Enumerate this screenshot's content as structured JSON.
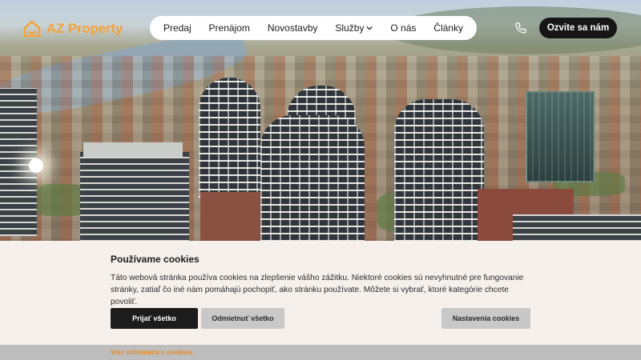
{
  "brand": {
    "name": "AZ Property",
    "accent_color": "#f3a23c"
  },
  "nav": {
    "items": [
      {
        "label": "Predaj"
      },
      {
        "label": "Prenájom"
      },
      {
        "label": "Novostavby"
      },
      {
        "label": "Služby",
        "has_dropdown": true
      },
      {
        "label": "O nás"
      },
      {
        "label": "Články"
      }
    ]
  },
  "header": {
    "phone_icon": "phone-icon",
    "cta_label": "Ozvite sa nám"
  },
  "cookies": {
    "title": "Používame cookies",
    "text": "Táto webová stránka používa cookies na zlepšenie vášho zážitku. Niektoré cookies sú nevyhnutné pre fungovanie stránky, zatiaľ čo iné nám pomáhajú pochopiť, ako stránku používate. Môžete si vybrať, ktoré kategórie chcete povoliť.",
    "accept_label": "Prijať všetko",
    "reject_label": "Odmietnuť všetko",
    "settings_label": "Nastavenia cookies",
    "more_link": "Viac informácií o cookies.",
    "link_color": "#f08a18"
  }
}
